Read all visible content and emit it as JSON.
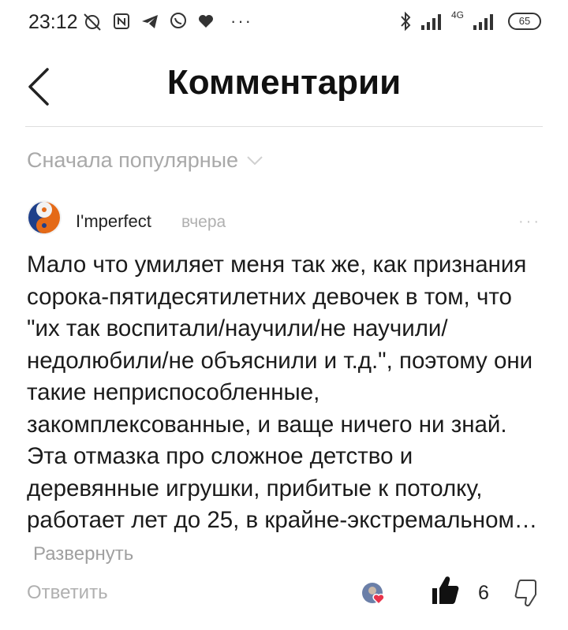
{
  "status_bar": {
    "time": "23:12",
    "network": "4G",
    "battery": "65",
    "more": "···"
  },
  "header": {
    "title": "Комментарии",
    "back_icon": "chevron-left-icon"
  },
  "sort": {
    "label": "Сначала популярные",
    "icon": "chevron-down-icon"
  },
  "comment": {
    "author": "I'mperfect",
    "time": "вчера",
    "more": "···",
    "text": "Мало что умиляет меня так же, как признания сорока-пятидесятилетних девочек в том, что \"их так воспитали/научили/не научили/недолюбили/не объяснили и т.д.\", поэтому они такие неприспособленные, закомплексованные, и ваще ничего ни знай. Эта отмазка про сложное детство и деревянные игрушки, прибитые к потолку, работает лет до 25, в крайне-экстремальном…",
    "expand": "Развернуть",
    "reply": "Ответить",
    "likes": "6"
  },
  "colors": {
    "text": "#1b1b1b",
    "muted": "#a9a9a9",
    "divider": "#dedede",
    "heart": "#e8334a"
  }
}
